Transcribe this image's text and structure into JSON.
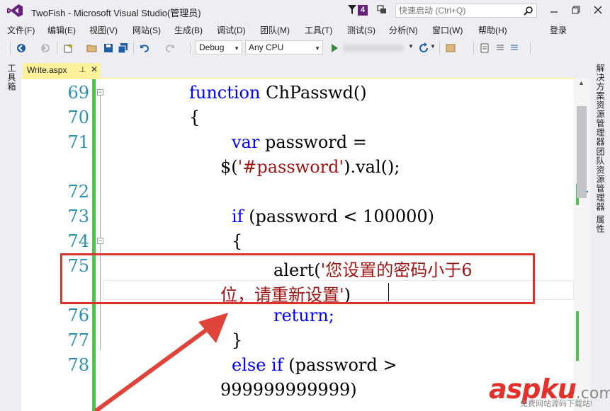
{
  "window": {
    "title": "TwoFish - Microsoft Visual Studio(管理员)",
    "notification_count": "4",
    "quick_launch_placeholder": "快速启动 (Ctrl+Q)"
  },
  "menu": {
    "items": [
      "文件(F)",
      "编辑(E)",
      "视图(V)",
      "网站(S)",
      "生成(B)",
      "调试(D)",
      "团队(M)",
      "工具(T)",
      "测试(S)",
      "分析(N)",
      "窗口(W)",
      "帮助(H)"
    ],
    "signin": "登录"
  },
  "toolbar": {
    "configuration": "Debug",
    "platform": "Any CPU"
  },
  "left_rail": {
    "toolbox": "工具箱"
  },
  "right_rail": {
    "solution_explorer": "解决方案资源管理器",
    "team_explorer": "团队资源管理器",
    "properties": "属性"
  },
  "document_tab": {
    "label": "Write.aspx"
  },
  "editor": {
    "line_numbers": [
      "69",
      "70",
      "71",
      "72",
      "73",
      "74",
      "75",
      "76",
      "77",
      "78"
    ],
    "lines": [
      {
        "parts": [
          {
            "t": "function",
            "k": "kw"
          },
          {
            "t": " ChPasswd()",
            "k": ""
          }
        ]
      },
      {
        "parts": [
          {
            "t": "{",
            "k": ""
          }
        ]
      },
      {
        "parts": [
          {
            "t": "var",
            "k": "kw"
          },
          {
            "t": " password =",
            "k": ""
          }
        ]
      },
      {
        "parts": [
          {
            "t": "$(",
            "k": ""
          },
          {
            "t": "'#password'",
            "k": "str"
          },
          {
            "t": ").val();",
            "k": ""
          }
        ]
      },
      {
        "parts": [
          {
            "t": "if",
            "k": "kw"
          },
          {
            "t": " (password < 100000)",
            "k": ""
          }
        ]
      },
      {
        "parts": [
          {
            "t": "{",
            "k": ""
          }
        ]
      },
      {
        "parts": [
          {
            "t": "alert(",
            "k": ""
          },
          {
            "t": "'您设置的密码小于6",
            "k": "str"
          }
        ]
      },
      {
        "parts": [
          {
            "t": "位，请重新设置'",
            "k": "str"
          },
          {
            "t": ")",
            "k": ""
          }
        ]
      },
      {
        "parts": [
          {
            "t": "return;",
            "k": "kw"
          }
        ]
      },
      {
        "parts": [
          {
            "t": "}",
            "k": ""
          }
        ]
      },
      {
        "parts": [
          {
            "t": "else",
            "k": "kw"
          },
          {
            "t": " ",
            "k": ""
          },
          {
            "t": "if",
            "k": "kw"
          },
          {
            "t": " (password >",
            "k": ""
          }
        ]
      },
      {
        "parts": [
          {
            "t": "999999999999)",
            "k": ""
          }
        ]
      }
    ]
  },
  "watermark": {
    "logo": "aspku",
    "suffix": ".com",
    "subtitle": "免费网站源码下载站!"
  },
  "colors": {
    "keyword": "#0000ff",
    "string": "#a31515",
    "line_number": "#2b91af",
    "highlight_box": "#d9342b",
    "tab_active": "#fff29d",
    "vs_purple": "#68217a"
  }
}
